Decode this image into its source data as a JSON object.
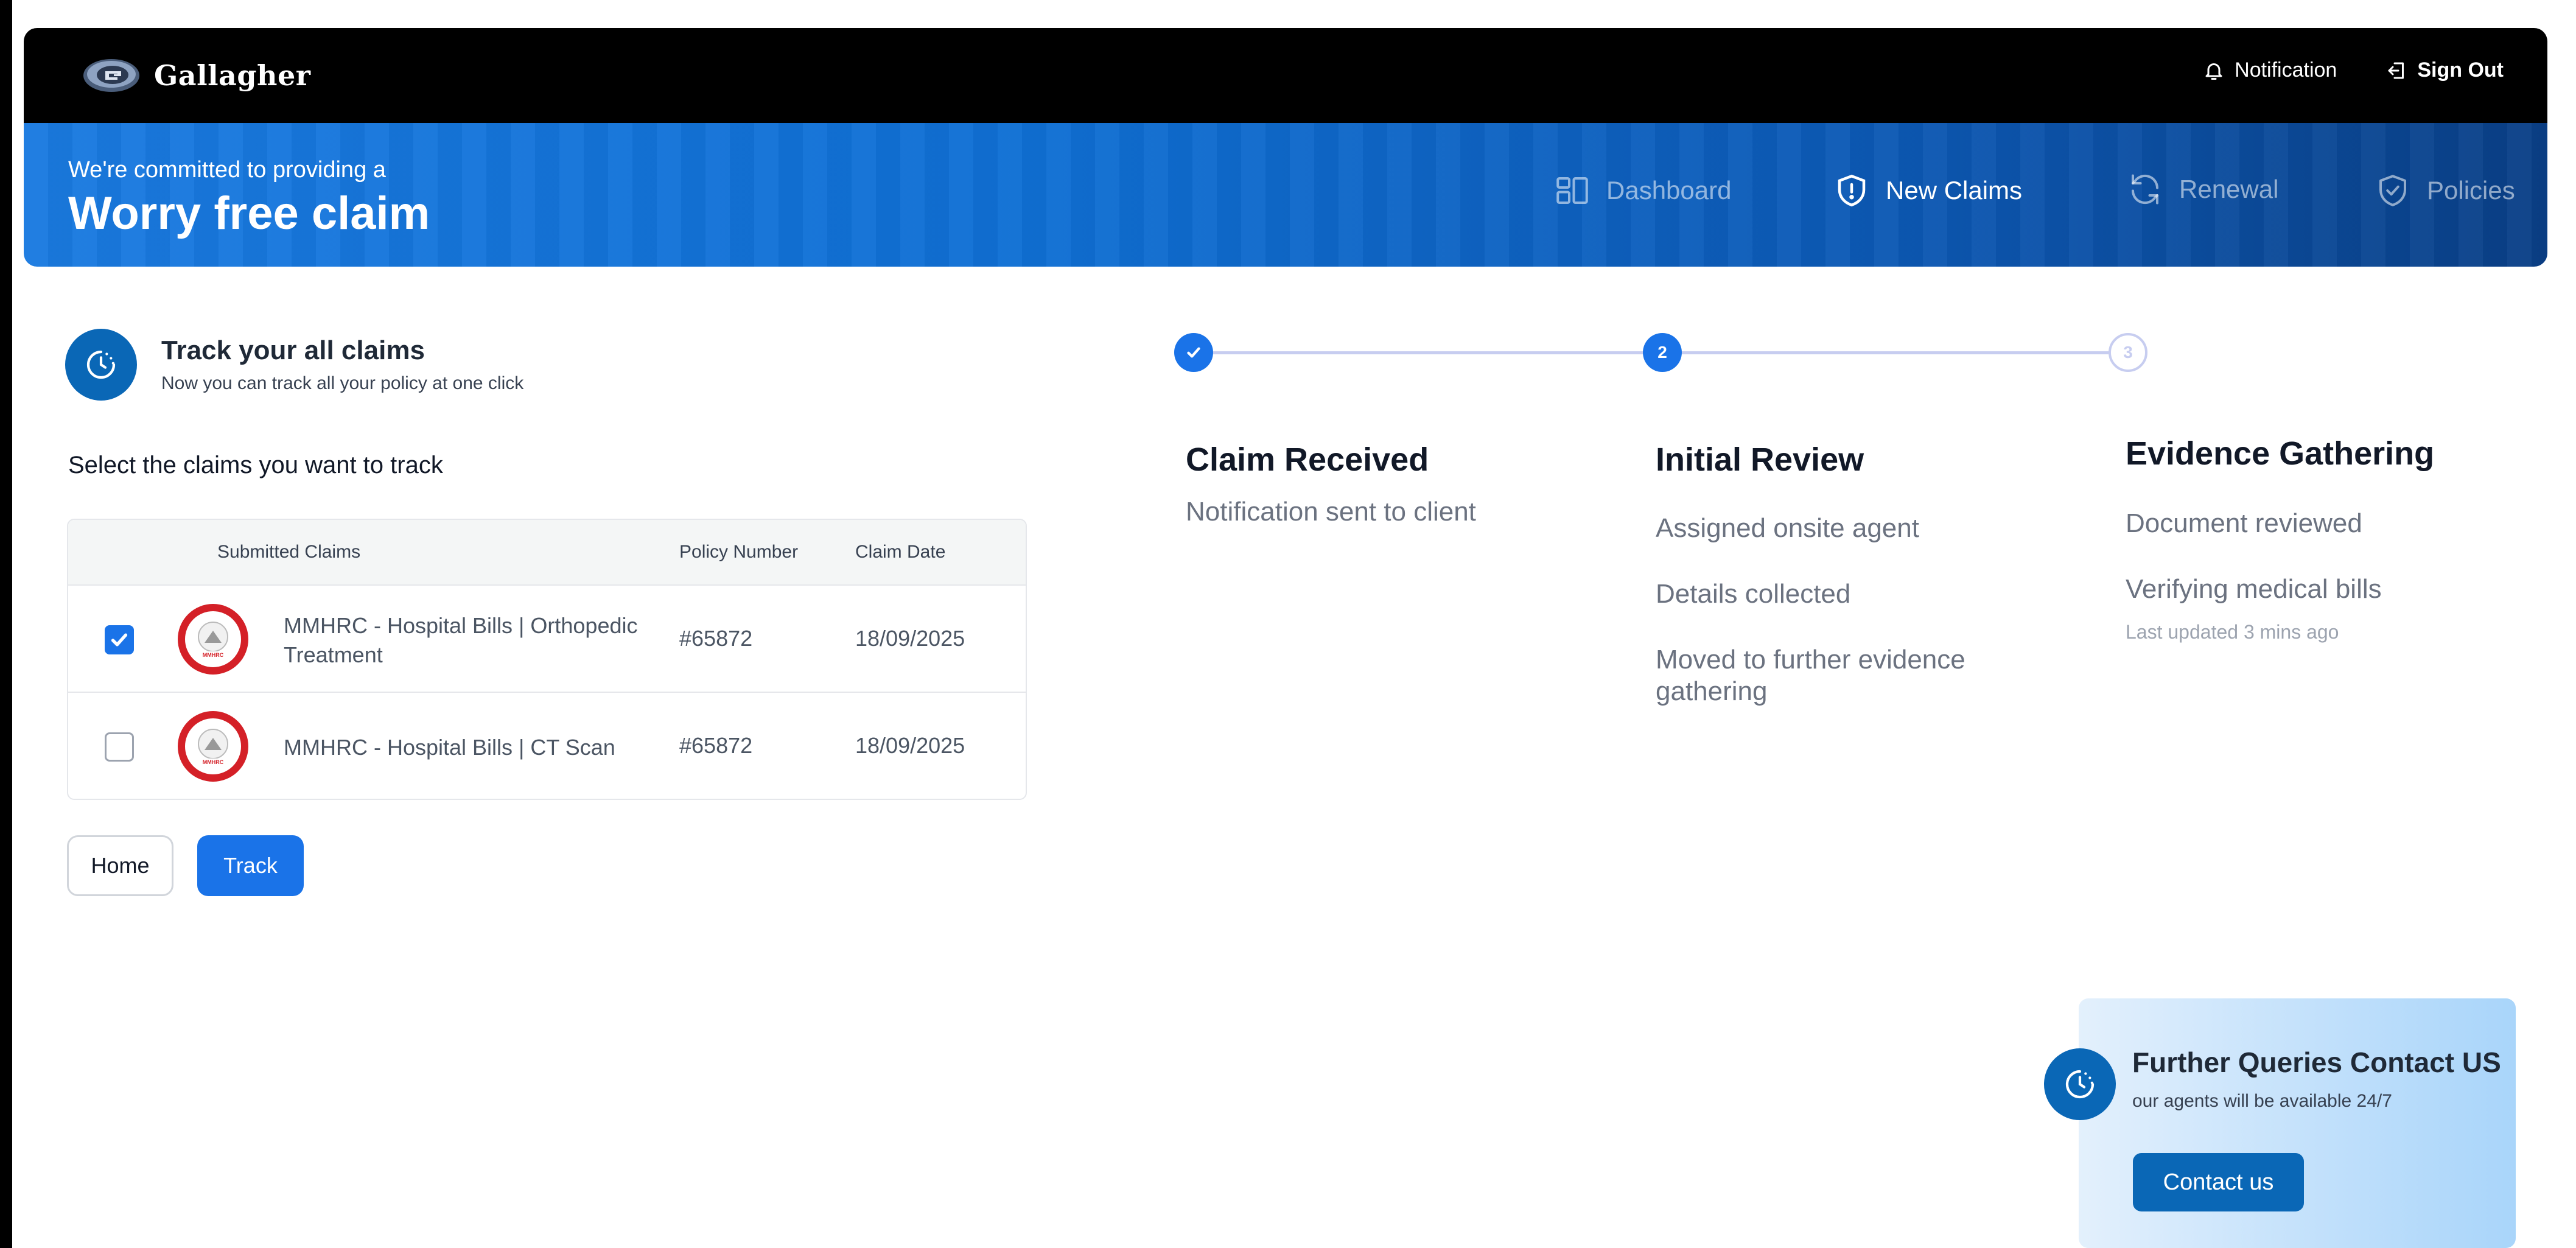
{
  "header": {
    "brand": "Gallagher",
    "notification_label": "Notification",
    "signout_label": "Sign Out"
  },
  "banner": {
    "subtitle": "We're committed to providing a",
    "title": "Worry free claim"
  },
  "nav": {
    "items": [
      {
        "label": "Dashboard",
        "icon": "dashboard-icon",
        "active": false
      },
      {
        "label": "New Claims",
        "icon": "shield-alert-icon",
        "active": true
      },
      {
        "label": "Renewal",
        "icon": "refresh-icon",
        "active": false
      },
      {
        "label": "Policies",
        "icon": "shield-check-icon",
        "active": false
      }
    ]
  },
  "track": {
    "title": "Track your all claims",
    "subtitle": "Now you can track all your policy at one click",
    "select_label": "Select the claims you want to track"
  },
  "table": {
    "headers": [
      "Submitted Claims",
      "Policy Number",
      "Claim Date"
    ],
    "rows": [
      {
        "checked": true,
        "logo": "MMHRC",
        "claim": "MMHRC - Hospital Bills | Orthopedic Treatment",
        "policy": "#65872",
        "date": "18/09/2025"
      },
      {
        "checked": false,
        "logo": "MMHRC",
        "claim": "MMHRC - Hospital Bills | CT Scan",
        "policy": "#65872",
        "date": "18/09/2025"
      }
    ]
  },
  "buttons": {
    "home": "Home",
    "track": "Track"
  },
  "stepper": {
    "steps": [
      {
        "status": "done",
        "number": "",
        "title": "Claim Received",
        "items": [
          "Notification sent to client"
        ]
      },
      {
        "status": "current",
        "number": "2",
        "title": "Initial Review",
        "items": [
          "Assigned onsite agent",
          "Details collected",
          "Moved to further evidence gathering"
        ]
      },
      {
        "status": "pending",
        "number": "3",
        "title": "Evidence Gathering",
        "items": [
          "Document reviewed",
          "Verifying medical bills"
        ],
        "note": "Last updated 3 mins ago"
      }
    ]
  },
  "contact": {
    "title": "Further Queries Contact US",
    "subtitle": "our agents will be available 24/7",
    "button": "Contact us"
  },
  "colors": {
    "primary": "#1a73e8",
    "dark_blue": "#0a67b6",
    "header_bg": "#000000",
    "banner_start": "#1a7ae0",
    "banner_end": "#0a3f86"
  }
}
